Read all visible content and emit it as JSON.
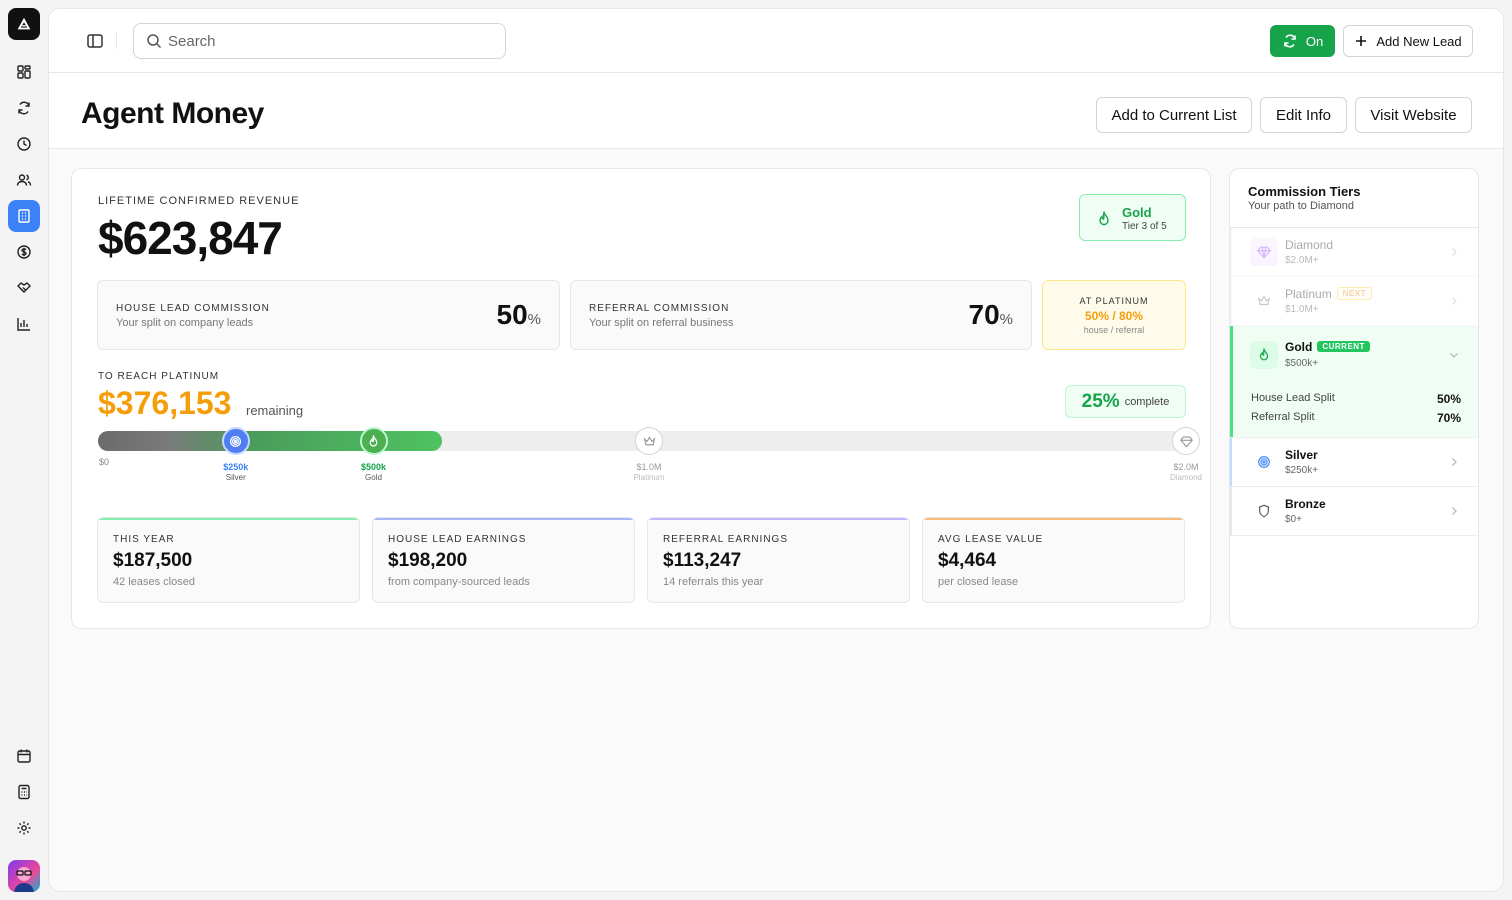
{
  "colors": {
    "accent": "#3b82f6",
    "success": "#16a34a",
    "amber": "#f59e0b"
  },
  "rail": {
    "logo_icon": "app-logo-icon",
    "nav": [
      {
        "name": "dashboard-icon",
        "active": false
      },
      {
        "name": "sync-icon",
        "active": false
      },
      {
        "name": "clock-icon",
        "active": false
      },
      {
        "name": "users-icon",
        "active": false
      },
      {
        "name": "building-icon",
        "active": true
      },
      {
        "name": "dollar-icon",
        "active": false
      },
      {
        "name": "handshake-icon",
        "active": false
      },
      {
        "name": "bar-chart-icon",
        "active": false
      },
      {
        "name": "calendar-icon",
        "active": false
      },
      {
        "name": "calculator-icon",
        "active": false
      },
      {
        "name": "settings-icon",
        "active": false
      }
    ]
  },
  "topbar": {
    "search_placeholder": "Search",
    "toggle_label": "On",
    "add_lead_label": "Add New Lead"
  },
  "header": {
    "title": "Agent Money",
    "buttons": {
      "add_to_list": "Add to Current List",
      "edit_info": "Edit Info",
      "visit_website": "Visit Website"
    }
  },
  "revenue": {
    "label": "LIFETIME CONFIRMED REVENUE",
    "value": "$623,847",
    "tier_badge": {
      "name": "Gold",
      "sub": "Tier 3 of 5"
    }
  },
  "commissions": [
    {
      "title": "HOUSE LEAD COMMISSION",
      "sub": "Your split on company leads",
      "value": "50",
      "unit": "%"
    },
    {
      "title": "REFERRAL COMMISSION",
      "sub": "Your split on referral business",
      "value": "70",
      "unit": "%"
    }
  ],
  "at_platinum": {
    "title": "AT PLATINUM",
    "value": "50% / 80%",
    "sub": "house / referral"
  },
  "progress": {
    "label": "TO REACH PLATINUM",
    "value": "$376,153",
    "suffix": "remaining",
    "complete_value": "25%",
    "complete_label": "complete",
    "fill_fraction": 0.312,
    "start_label": "$0",
    "milestones": [
      {
        "value": "$250k",
        "name": "Silver",
        "fraction": 0.125
      },
      {
        "value": "$500k",
        "name": "Gold",
        "fraction": 0.25
      },
      {
        "value": "$1.0M",
        "name": "Platinum",
        "fraction": 0.5
      },
      {
        "value": "$2.0M",
        "name": "Diamond",
        "fraction": 1.0
      }
    ]
  },
  "stats": [
    {
      "title": "THIS YEAR",
      "value": "$187,500",
      "sub": "42 leases closed",
      "color": "#86efac"
    },
    {
      "title": "HOUSE LEAD EARNINGS",
      "value": "$198,200",
      "sub": "from company-sourced leads",
      "color": "#a5b4fc"
    },
    {
      "title": "REFERRAL EARNINGS",
      "value": "$113,247",
      "sub": "14 referrals this year",
      "color": "#c4b5fd"
    },
    {
      "title": "AVG LEASE VALUE",
      "value": "$4,464",
      "sub": "per closed lease",
      "color": "#fdba74"
    }
  ],
  "tiers": {
    "title": "Commission Tiers",
    "subtitle": "Your path to Diamond",
    "items": [
      {
        "name": "Diamond",
        "min": "$2.0M+",
        "icon": "diamond-icon"
      },
      {
        "name": "Platinum",
        "min": "$1.0M+",
        "icon": "crown-icon",
        "badge": "NEXT"
      },
      {
        "name": "Gold",
        "min": "$500k+",
        "icon": "flame-icon",
        "badge": "CURRENT",
        "splits": [
          {
            "label": "House Lead Split",
            "value": "50%"
          },
          {
            "label": "Referral Split",
            "value": "70%"
          }
        ]
      },
      {
        "name": "Silver",
        "min": "$250k+",
        "icon": "target-icon"
      },
      {
        "name": "Bronze",
        "min": "$0+",
        "icon": "shield-icon"
      }
    ]
  }
}
